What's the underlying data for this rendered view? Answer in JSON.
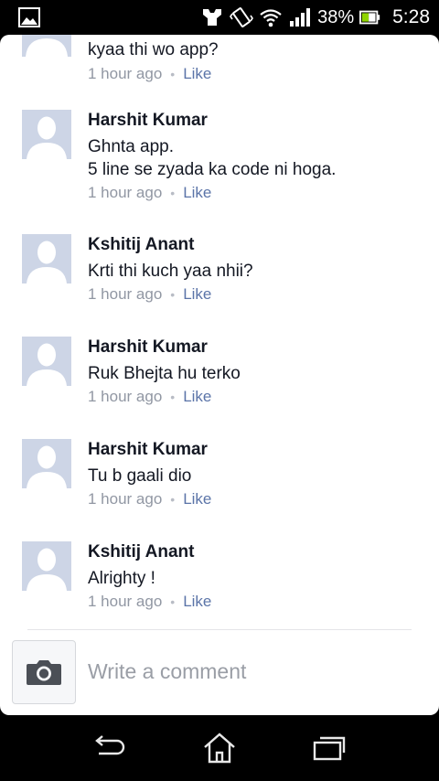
{
  "status_bar": {
    "battery_percent": "38%",
    "time": "5:28",
    "icons": [
      "gallery-icon",
      "media-icon",
      "vibrate-icon",
      "wifi-icon",
      "signal-icon",
      "battery-icon"
    ]
  },
  "comments": [
    {
      "name": "",
      "text": "kyaa thi wo app?",
      "time": "1 hour ago",
      "like": "Like"
    },
    {
      "name": "Harshit Kumar",
      "text": "Ghnta app.\n5 line se zyada ka code ni hoga.",
      "time": "1 hour ago",
      "like": "Like"
    },
    {
      "name": "Kshitij Anant",
      "text": "Krti thi kuch yaa nhii?",
      "time": "1 hour ago",
      "like": "Like"
    },
    {
      "name": "Harshit Kumar",
      "text": "Ruk Bhejta hu terko",
      "time": "1 hour ago",
      "like": "Like"
    },
    {
      "name": "Harshit Kumar",
      "text": "Tu b gaali dio",
      "time": "1 hour ago",
      "like": "Like"
    },
    {
      "name": "Kshitij Anant",
      "text": "Alrighty !",
      "time": "1 hour ago",
      "like": "Like"
    }
  ],
  "composer": {
    "placeholder": "Write a comment",
    "camera_icon": "camera-icon"
  },
  "nav_bar": {
    "icons": [
      "back-icon",
      "home-icon",
      "recent-apps-icon"
    ]
  },
  "colors": {
    "link": "#5b74a8",
    "meta": "#9197a3",
    "avatar_bg": "#cdd5e6",
    "background": "#000000"
  }
}
